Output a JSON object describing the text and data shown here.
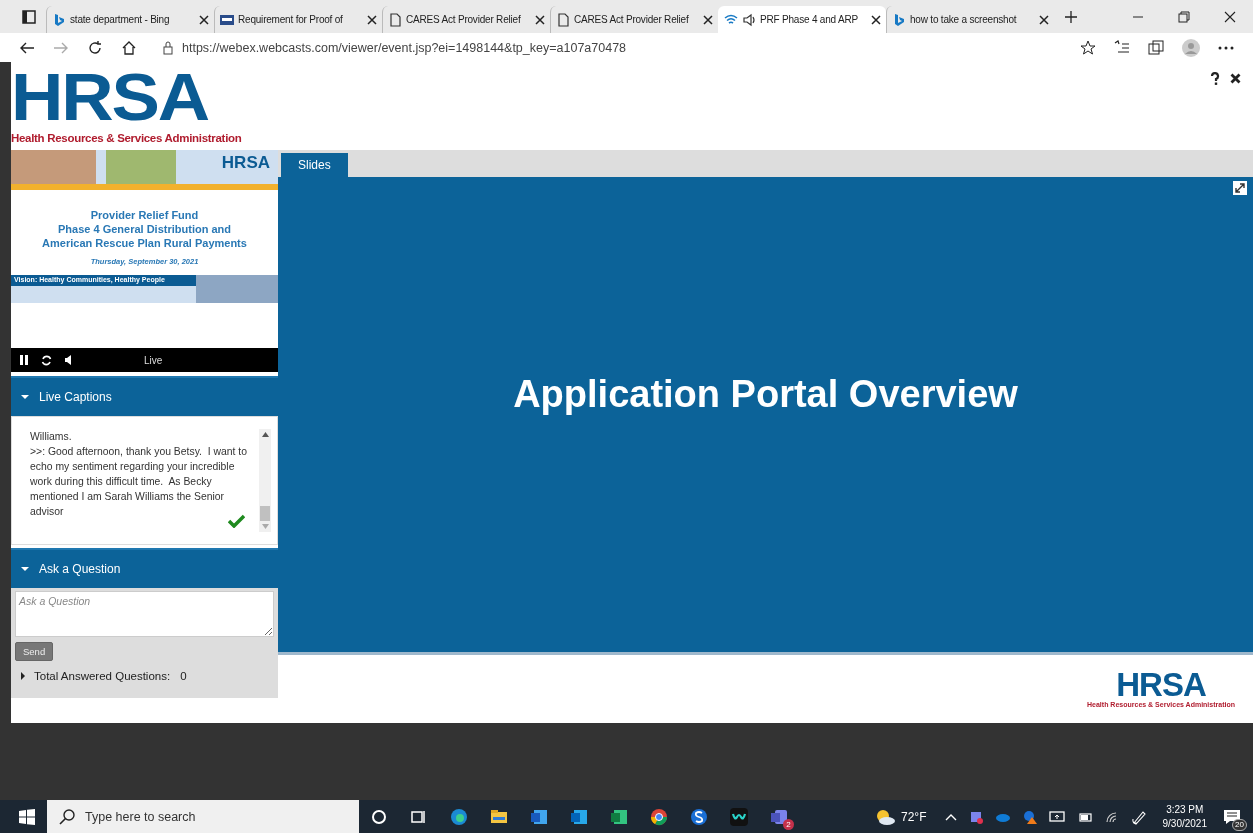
{
  "browser": {
    "tabs": [
      {
        "title": "state department - Bing",
        "kind": "search",
        "selected": false,
        "audio": false
      },
      {
        "title": "Requirement for Proof of",
        "kind": "site",
        "selected": false,
        "audio": false
      },
      {
        "title": "CARES Act Provider Relief",
        "kind": "page",
        "selected": false,
        "audio": false
      },
      {
        "title": "CARES Act Provider Relief",
        "kind": "page",
        "selected": false,
        "audio": false
      },
      {
        "title": "PRF Phase 4 and ARP",
        "kind": "live",
        "selected": true,
        "audio": true
      },
      {
        "title": "how to take a screenshot",
        "kind": "search",
        "selected": false,
        "audio": false
      }
    ],
    "url": "https://webex.webcasts.com/viewer/event.jsp?ei=1498144&tp_key=a107a70478"
  },
  "header": {
    "logo": "HRSA",
    "subtitle": "Health Resources & Services Administration"
  },
  "video": {
    "logo": "HRSA",
    "title_lines": [
      "Provider Relief Fund",
      "Phase 4 General Distribution and",
      "American Rescue Plan Rural Payments"
    ],
    "date": "Thursday, September 30, 2021",
    "vision": "Vision: Healthy Communities, Healthy People",
    "status": "Live",
    "playing": true
  },
  "captions": {
    "title": "Live Captions",
    "expanded": true,
    "text": "Williams.\n>>: Good afternoon, thank you Betsy.  I want to echo my sentiment regarding your incredible work during this difficult time.  As Becky mentioned I am Sarah Williams the Senior advisor",
    "confirmed": true
  },
  "question": {
    "title": "Ask a Question",
    "expanded": true,
    "placeholder": "Ask a Question",
    "send": "Send",
    "total_label": "Total Answered Questions:",
    "total": "0",
    "total_expanded": false
  },
  "content_tabs": [
    {
      "label": "Slides",
      "selected": true
    }
  ],
  "slide": {
    "title": "Application Portal Overview"
  },
  "footer": {
    "logo": "HRSA",
    "subtitle": "Health Resources & Services Administration"
  },
  "taskbar": {
    "search_placeholder": "Type here to search",
    "teams_badge": "2",
    "weather": "72°F",
    "time": "3:23 PM",
    "date": "9/30/2021",
    "notifications": "20"
  }
}
